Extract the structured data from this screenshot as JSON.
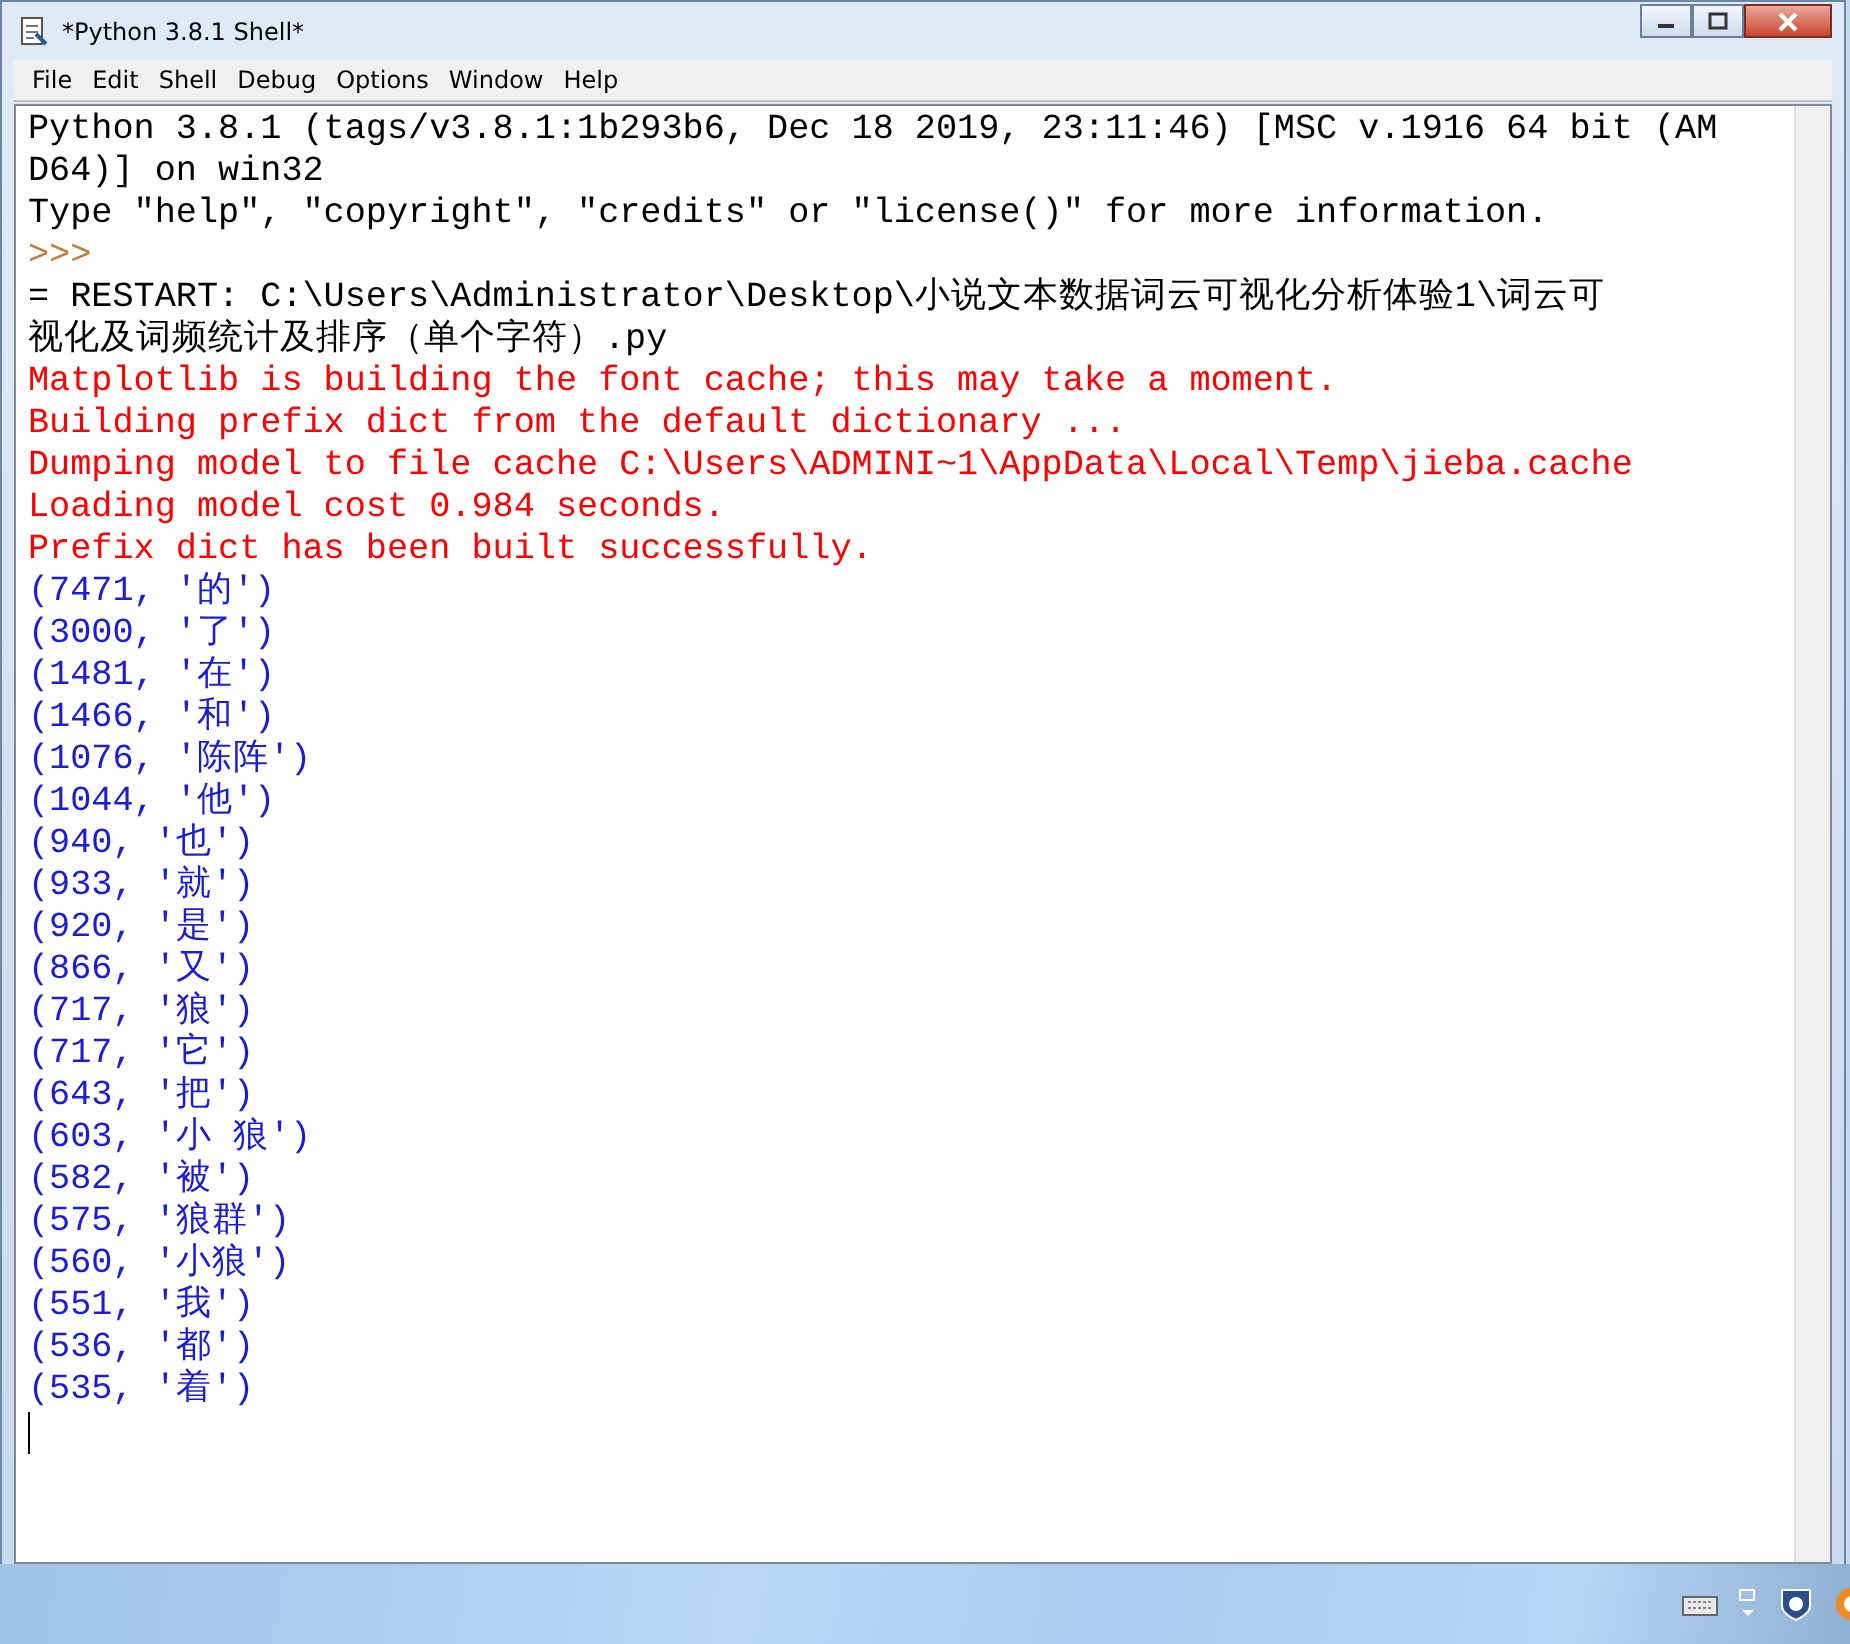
{
  "window": {
    "title": "*Python 3.8.1 Shell*"
  },
  "menu": [
    {
      "label": "File"
    },
    {
      "label": "Edit"
    },
    {
      "label": "Shell"
    },
    {
      "label": "Debug"
    },
    {
      "label": "Options"
    },
    {
      "label": "Window"
    },
    {
      "label": "Help"
    }
  ],
  "shell_lines": [
    {
      "kind": "output",
      "text": "Python 3.8.1 (tags/v3.8.1:1b293b6, Dec 18 2019, 23:11:46) [MSC v.1916 64 bit (AM"
    },
    {
      "kind": "output",
      "text": "D64)] on win32"
    },
    {
      "kind": "output",
      "text": "Type \"help\", \"copyright\", \"credits\" or \"license()\" for more information."
    },
    {
      "kind": "prompt",
      "text": ">>>"
    },
    {
      "kind": "output",
      "text": "= RESTART: C:\\Users\\Administrator\\Desktop\\小说文本数据词云可视化分析体验1\\词云可"
    },
    {
      "kind": "output",
      "text": "视化及词频统计及排序（单个字符）.py"
    },
    {
      "kind": "error",
      "text": "Matplotlib is building the font cache; this may take a moment."
    },
    {
      "kind": "error",
      "text": "Building prefix dict from the default dictionary ..."
    },
    {
      "kind": "error",
      "text": "Dumping model to file cache C:\\Users\\ADMINI~1\\AppData\\Local\\Temp\\jieba.cache"
    },
    {
      "kind": "error",
      "text": "Loading model cost 0.984 seconds."
    },
    {
      "kind": "error",
      "text": "Prefix dict has been built successfully."
    },
    {
      "kind": "result",
      "text": "(7471, '的')"
    },
    {
      "kind": "result",
      "text": "(3000, '了')"
    },
    {
      "kind": "result",
      "text": "(1481, '在')"
    },
    {
      "kind": "result",
      "text": "(1466, '和')"
    },
    {
      "kind": "result",
      "text": "(1076, '陈阵')"
    },
    {
      "kind": "result",
      "text": "(1044, '他')"
    },
    {
      "kind": "result",
      "text": "(940, '也')"
    },
    {
      "kind": "result",
      "text": "(933, '就')"
    },
    {
      "kind": "result",
      "text": "(920, '是')"
    },
    {
      "kind": "result",
      "text": "(866, '又')"
    },
    {
      "kind": "result",
      "text": "(717, '狼')"
    },
    {
      "kind": "result",
      "text": "(717, '它')"
    },
    {
      "kind": "result",
      "text": "(643, '把')"
    },
    {
      "kind": "result",
      "text": "(603, '小 狼')"
    },
    {
      "kind": "result",
      "text": "(582, '被')"
    },
    {
      "kind": "result",
      "text": "(575, '狼群')"
    },
    {
      "kind": "result",
      "text": "(560, '小狼')"
    },
    {
      "kind": "result",
      "text": "(551, '我')"
    },
    {
      "kind": "result",
      "text": "(536, '都')"
    },
    {
      "kind": "result",
      "text": "(535, '着')"
    }
  ]
}
